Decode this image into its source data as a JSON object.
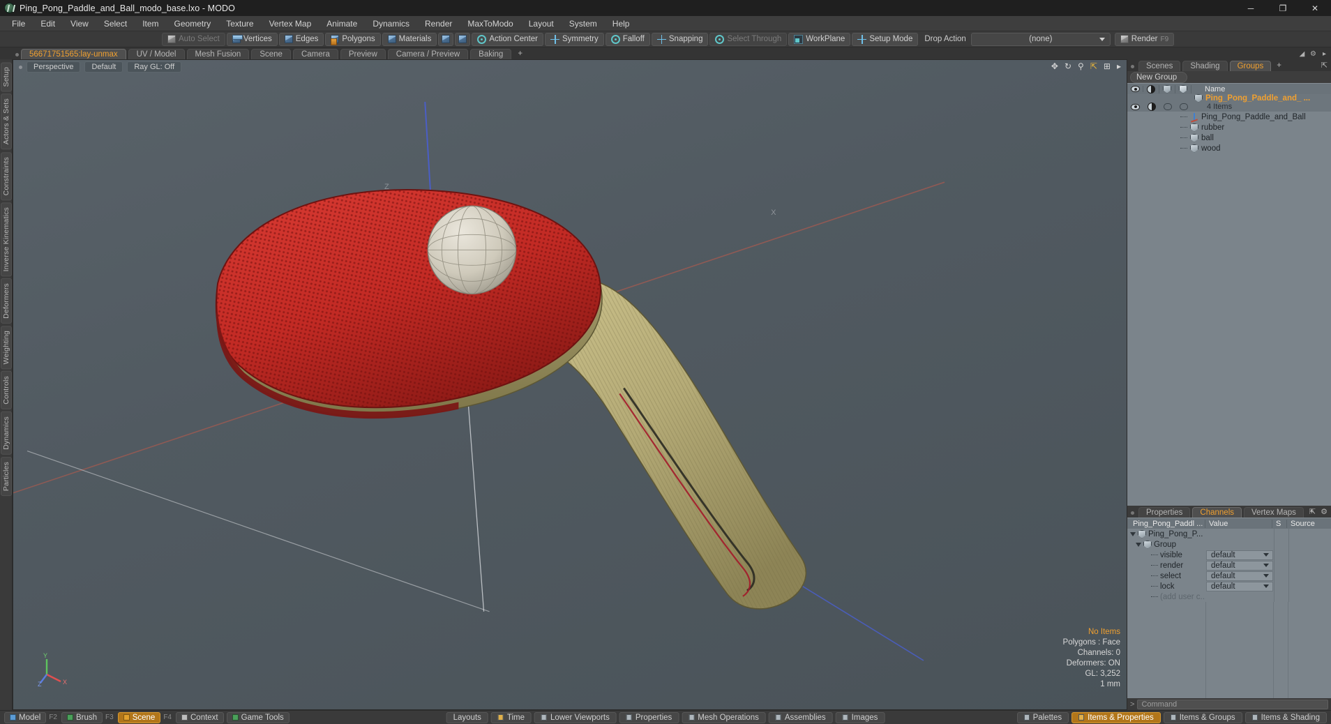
{
  "window": {
    "title": "Ping_Pong_Paddle_and_Ball_modo_base.lxo - MODO",
    "app_icon": "modo-logo-icon",
    "minimize": "─",
    "maximize": "❐",
    "close": "✕"
  },
  "menubar": {
    "items": [
      "File",
      "Edit",
      "View",
      "Select",
      "Item",
      "Geometry",
      "Texture",
      "Vertex Map",
      "Animate",
      "Dynamics",
      "Render",
      "MaxToModo",
      "Layout",
      "System",
      "Help"
    ]
  },
  "toolbar": {
    "buttons": [
      {
        "label": "Auto Select",
        "icon": "cube-grey-icon",
        "enabled": false
      },
      {
        "label": "Vertices",
        "icon": "cube-vertices-icon",
        "enabled": true
      },
      {
        "label": "Edges",
        "icon": "cube-edges-icon",
        "enabled": true
      },
      {
        "label": "Polygons",
        "icon": "cube-polygons-icon",
        "enabled": true
      },
      {
        "label": "Materials",
        "icon": "cube-materials-icon",
        "enabled": true
      }
    ],
    "icon_buttons": [
      "pivot-icon",
      "center-icon"
    ],
    "modes": [
      {
        "label": "Action Center",
        "icon": "action-center-icon"
      },
      {
        "label": "Symmetry",
        "icon": "symmetry-icon"
      },
      {
        "label": "Falloff",
        "icon": "falloff-icon"
      },
      {
        "label": "Snapping",
        "icon": "snapping-icon"
      },
      {
        "label": "Select Through",
        "icon": "select-through-icon",
        "enabled": false
      },
      {
        "label": "WorkPlane",
        "icon": "workplane-icon"
      },
      {
        "label": "Setup Mode",
        "icon": "setup-mode-icon"
      }
    ],
    "drop_action_label": "Drop Action",
    "drop_action_value": "(none)",
    "render_label": "Render",
    "render_key": "F9"
  },
  "viewport_tabs": {
    "items": [
      "56671751565:lay-unmax",
      "UV / Model",
      "Mesh Fusion",
      "Scene",
      "Camera",
      "Preview",
      "Camera / Preview",
      "Baking"
    ],
    "active_index": 0,
    "add": "+"
  },
  "left_rail": {
    "items": [
      "Setup",
      "Actors & Sets",
      "Constraints",
      "Inverse Kinematics",
      "Deformers",
      "Weighting",
      "Controls",
      "Dynamics",
      "Particles"
    ]
  },
  "viewport": {
    "view_name": "Perspective",
    "shading": "Default",
    "ray_gl": "Ray GL: Off",
    "tools": [
      "pan-icon",
      "rotate-icon",
      "zoom-icon",
      "fit-icon",
      "more-icon",
      "menu-icon"
    ],
    "stats": {
      "items": "No Items",
      "polygons": "Polygons : Face",
      "channels": "Channels: 0",
      "deformers": "Deformers: ON",
      "gl": "GL: 3,252",
      "unit": "1 mm"
    },
    "axis_labels": {
      "x": "X",
      "y": "Y",
      "z": "Z"
    },
    "accent_color": "#f0a030"
  },
  "right_panel": {
    "tabs": [
      "Scenes",
      "Shading",
      "Groups"
    ],
    "active_tab": "Groups",
    "add": "+",
    "new_group_button": "New Group",
    "tree_columns": [
      "visibility-icon",
      "render-icon",
      "select-icon",
      "lock-icon",
      "Name"
    ],
    "group_row": {
      "name": "Ping_Pong_Paddle_and_ ...",
      "sub": "4 Items"
    },
    "children": [
      {
        "name": "Ping_Pong_Paddle_and_Ball",
        "icon": "locator-icon"
      },
      {
        "name": "rubber",
        "icon": "mesh-icon"
      },
      {
        "name": "ball",
        "icon": "mesh-icon"
      },
      {
        "name": "wood",
        "icon": "mesh-icon"
      }
    ]
  },
  "channels_panel": {
    "tabs": [
      "Properties",
      "Channels",
      "Vertex Maps"
    ],
    "active_tab": "Channels",
    "add": "+",
    "columns": [
      "Ping_Pong_Paddl ...",
      "Value",
      "S",
      "Source"
    ],
    "rows": [
      {
        "name": "Ping_Pong_P...",
        "value": "",
        "depth": 0,
        "icon": "mesh-icon",
        "toggle": "expanded"
      },
      {
        "name": "Group",
        "value": "",
        "depth": 1,
        "icon": "mesh-icon",
        "toggle": "expanded"
      },
      {
        "name": "visible",
        "value": "default",
        "depth": 2
      },
      {
        "name": "render",
        "value": "default",
        "depth": 2
      },
      {
        "name": "select",
        "value": "default",
        "depth": 2
      },
      {
        "name": "lock",
        "value": "default",
        "depth": 2
      },
      {
        "name": "(add user c...",
        "value": "",
        "depth": 2,
        "dim": true
      }
    ]
  },
  "command_bar": {
    "prompt": ">",
    "placeholder": "Command"
  },
  "bottom_bar": {
    "left_modes": [
      {
        "label": "Model",
        "key": "F2",
        "swatch": "blue",
        "active": false
      },
      {
        "label": "Brush",
        "key": "F3",
        "swatch": "green",
        "active": false
      },
      {
        "label": "Scene",
        "key": "F4",
        "swatch": "orange",
        "active": true
      },
      {
        "label": "Context",
        "key": "",
        "swatch": "white",
        "active": false
      },
      {
        "label": "Game Tools",
        "key": "",
        "swatch": "green",
        "active": false
      }
    ],
    "center_buttons": [
      "Layouts",
      "Time",
      "Lower Viewports",
      "Properties",
      "Mesh Operations",
      "Assemblies",
      "Images"
    ],
    "right_buttons": [
      {
        "label": "Palettes",
        "active": false
      },
      {
        "label": "Items & Properties",
        "active": true
      },
      {
        "label": "Items & Groups",
        "active": false
      },
      {
        "label": "Items & Shading",
        "active": false
      }
    ]
  }
}
